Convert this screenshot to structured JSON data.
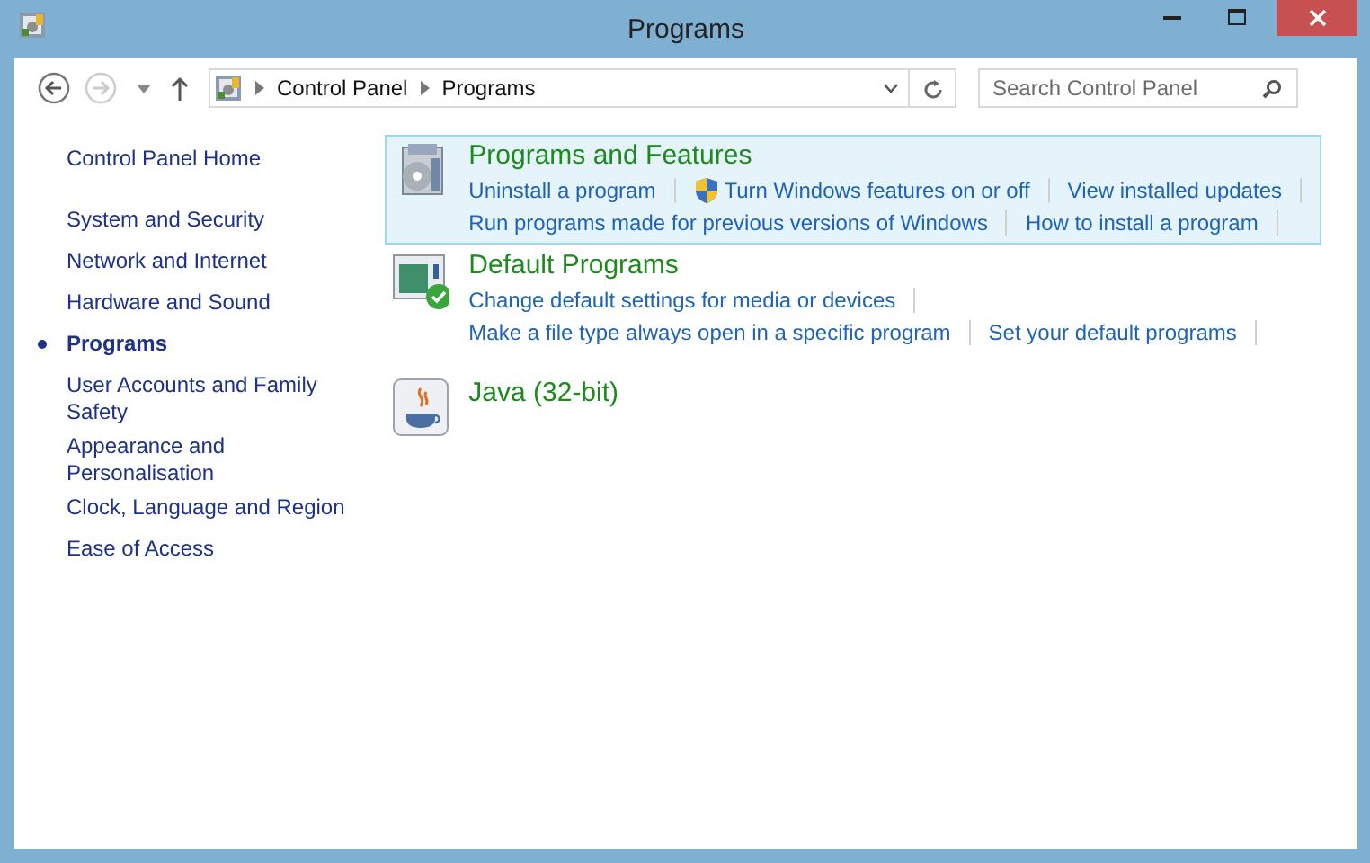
{
  "window": {
    "title": "Programs"
  },
  "address": {
    "crumbs": [
      "Control Panel",
      "Programs"
    ]
  },
  "search": {
    "placeholder": "Search Control Panel"
  },
  "sidebar": {
    "home": "Control Panel Home",
    "items": [
      {
        "label": "System and Security",
        "selected": false
      },
      {
        "label": "Network and Internet",
        "selected": false
      },
      {
        "label": "Hardware and Sound",
        "selected": false
      },
      {
        "label": "Programs",
        "selected": true
      },
      {
        "label": "User Accounts and Family Safety",
        "selected": false
      },
      {
        "label": "Appearance and Personalisation",
        "selected": false
      },
      {
        "label": "Clock, Language and Region",
        "selected": false
      },
      {
        "label": "Ease of Access",
        "selected": false
      }
    ]
  },
  "categories": [
    {
      "kind": "programs",
      "title": "Programs and Features",
      "selected": true,
      "link_rows": [
        [
          {
            "label": "Uninstall a program",
            "kind": "plain"
          },
          {
            "label": "Turn Windows features on or off",
            "kind": "admin"
          },
          {
            "label": "View installed updates",
            "kind": "plain"
          }
        ],
        [
          {
            "label": "Run programs made for previous versions of Windows",
            "kind": "plain"
          },
          {
            "label": "How to install a program",
            "kind": "plain"
          }
        ]
      ]
    },
    {
      "kind": "defaults",
      "title": "Default Programs",
      "selected": false,
      "link_rows": [
        [
          {
            "label": "Change default settings for media or devices",
            "kind": "plain"
          }
        ],
        [
          {
            "label": "Make a file type always open in a specific program",
            "kind": "plain"
          },
          {
            "label": "Set your default programs",
            "kind": "plain"
          }
        ]
      ]
    },
    {
      "kind": "java",
      "title": "Java (32-bit)",
      "selected": false
    }
  ]
}
